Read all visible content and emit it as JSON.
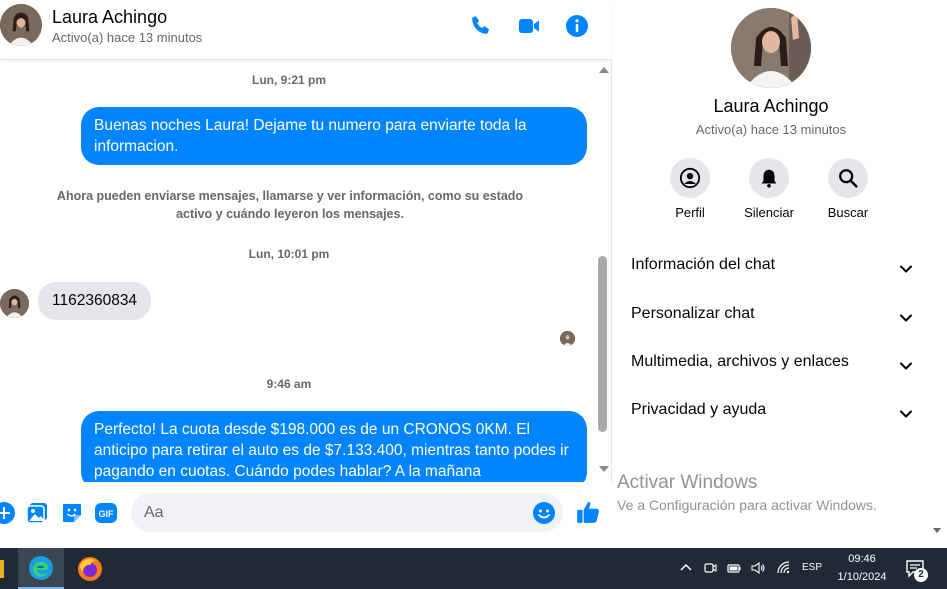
{
  "colors": {
    "accent": "#0084ff",
    "incoming_bubble": "#e4e6eb",
    "secondary_text": "#65676b",
    "taskbar": "#1f2a36"
  },
  "header": {
    "name": "Laura Achingo",
    "status": "Activo(a) hace 13 minutos",
    "icons": [
      "phone-icon",
      "video-camera-icon",
      "info-icon"
    ]
  },
  "conversation": {
    "timestamp_1": "Lun, 9:21 pm",
    "message_out_1": "Buenas noches Laura! Dejame tu numero para enviarte toda la informacion.",
    "system_notice": "Ahora pueden enviarse mensajes, llamarse y ver información, como su estado activo y cuándo leyeron los mensajes.",
    "timestamp_2": "Lun, 10:01 pm",
    "message_in_1": "1162360834",
    "timestamp_3": "9:46 am",
    "message_out_2": "Perfecto! La cuota desde $198.000 es de un CRONOS 0KM. El anticipo para retirar el auto es de $7.133.400, mientras tanto podes ir pagando en cuotas. Cuándo podes hablar? A la mañana"
  },
  "composer": {
    "placeholder": "Aa",
    "icons": [
      "plus-icon",
      "photo-icon",
      "sticker-icon",
      "gif-icon",
      "emoji-icon",
      "thumbs-up-icon"
    ],
    "gif_label": "GIF"
  },
  "info_panel": {
    "name": "Laura Achingo",
    "status": "Activo(a) hace 13 minutos",
    "actions": [
      {
        "label": "Perfil",
        "icon": "profile-icon"
      },
      {
        "label": "Silenciar",
        "icon": "bell-icon"
      },
      {
        "label": "Buscar",
        "icon": "search-icon"
      }
    ],
    "sections": [
      {
        "label": "Información del chat"
      },
      {
        "label": "Personalizar chat"
      },
      {
        "label": "Multimedia, archivos y enlaces"
      },
      {
        "label": "Privacidad y ayuda"
      }
    ]
  },
  "watermark": {
    "title": "Activar Windows",
    "subtitle": "Ve a Configuración para activar Windows."
  },
  "taskbar": {
    "apps": [
      "edge-icon",
      "firefox-icon"
    ],
    "language": "ESP",
    "time": "09:46",
    "date": "1/10/2024",
    "notification_count": "2"
  }
}
